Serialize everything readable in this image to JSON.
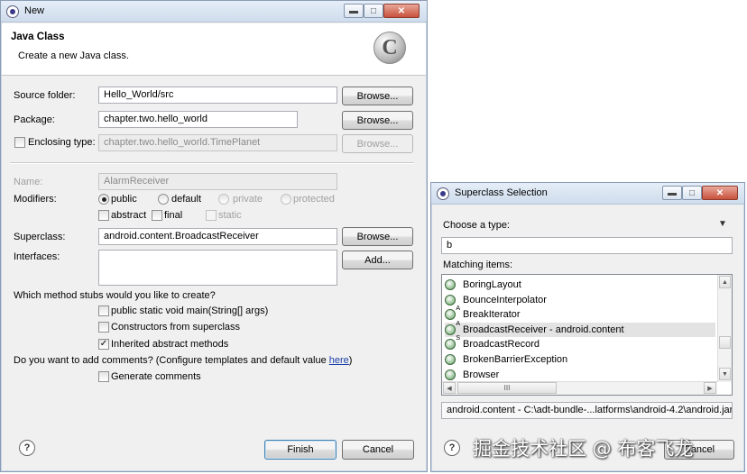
{
  "new_dialog": {
    "title": "New",
    "header_title": "Java Class",
    "header_desc": "Create a new Java class.",
    "source_folder": {
      "label": "Source folder:",
      "value": "Hello_World/src",
      "browse": "Browse..."
    },
    "package": {
      "label": "Package:",
      "value": "chapter.two.hello_world",
      "browse": "Browse..."
    },
    "enclosing": {
      "label": "Enclosing type:",
      "value": "chapter.two.hello_world.TimePlanet",
      "browse": "Browse..."
    },
    "name": {
      "label": "Name:",
      "value": "AlarmReceiver"
    },
    "modifiers": {
      "label": "Modifiers:",
      "public": "public",
      "default": "default",
      "private": "private",
      "protected": "protected",
      "abstract": "abstract",
      "final": "final",
      "static": "static"
    },
    "superclass": {
      "label": "Superclass:",
      "value": "android.content.BroadcastReceiver",
      "browse": "Browse..."
    },
    "interfaces": {
      "label": "Interfaces:",
      "add": "Add..."
    },
    "stubs": {
      "question": "Which method stubs would you like to create?",
      "main": "public static void main(String[] args)",
      "constructors": "Constructors from superclass",
      "inherited": "Inherited abstract methods"
    },
    "comments": {
      "question_pre": "Do you want to add comments? (Configure templates and default value ",
      "link": "here",
      "question_post": ")",
      "generate": "Generate comments"
    },
    "finish": "Finish",
    "cancel": "Cancel",
    "help": "?"
  },
  "superclass_dialog": {
    "title": "Superclass Selection",
    "choose_label": "Choose a type:",
    "filter_value": "b",
    "matching_label": "Matching items:",
    "items": [
      {
        "label": "BoringLayout",
        "mark": ""
      },
      {
        "label": "BounceInterpolator",
        "mark": ""
      },
      {
        "label": "BreakIterator",
        "mark": "A"
      },
      {
        "label": "BroadcastReceiver - android.content",
        "mark": "A"
      },
      {
        "label": "BroadcastRecord",
        "mark": "S"
      },
      {
        "label": "BrokenBarrierException",
        "mark": ""
      },
      {
        "label": "Browser",
        "mark": ""
      }
    ],
    "selected_index": 3,
    "h_scroll_grip": "III",
    "status": "android.content - C:\\adt-bundle-...latforms\\android-4.2\\android.jar",
    "cancel": "Cancel",
    "help": "?"
  },
  "watermark": "掘金技术社区 @ 布客飞龙",
  "colors": {
    "accent": "#3c7fb1",
    "titlebar": "#cfdcec",
    "close": "#c8503c"
  }
}
